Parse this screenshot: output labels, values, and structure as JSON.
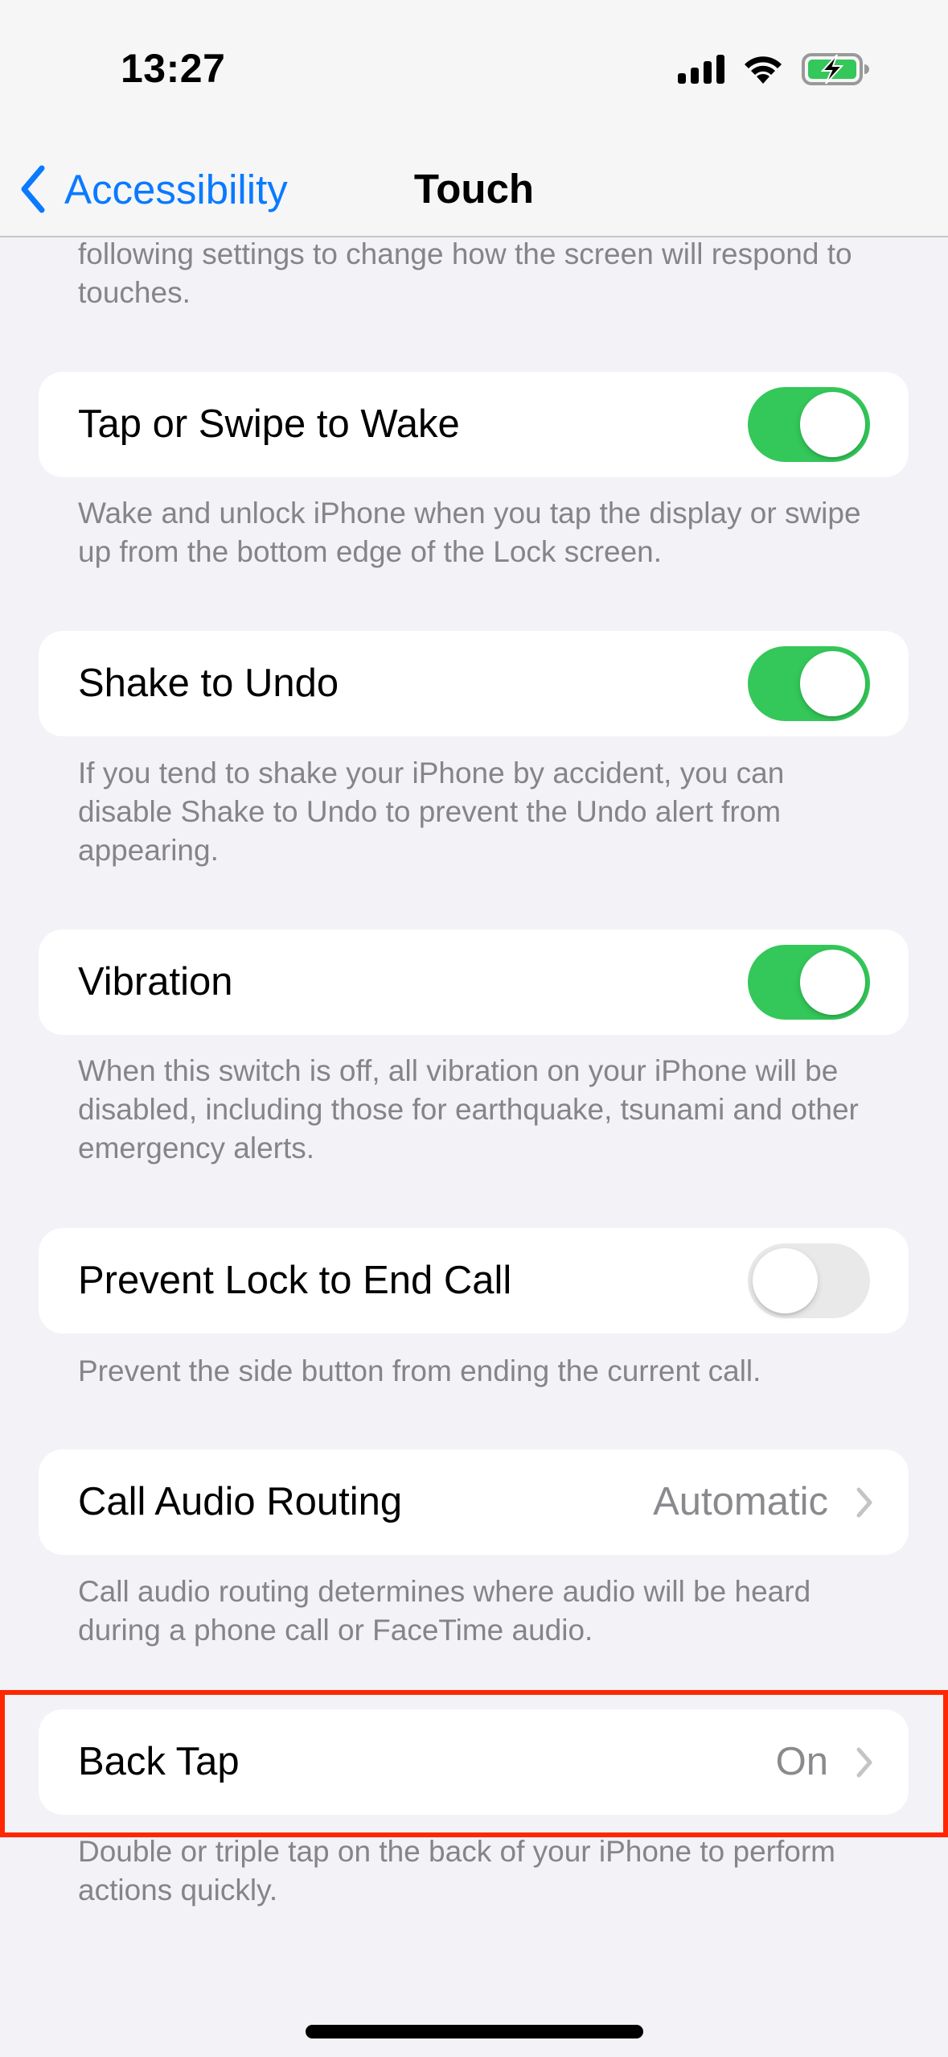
{
  "status_bar": {
    "time": "13:27",
    "icons": [
      "cellular-signal-icon",
      "wifi-icon",
      "battery-charging-icon"
    ],
    "battery_color": "#34c759"
  },
  "nav": {
    "back_label": "Accessibility",
    "title": "Touch",
    "accent_color": "#0a7aff"
  },
  "intro_text": "following settings to change how the screen will respond to touches.",
  "settings": [
    {
      "label": "Tap or Swipe to Wake",
      "control": "toggle",
      "state": "on",
      "description": "Wake and unlock iPhone when you tap the display or swipe up from the bottom edge of the Lock screen."
    },
    {
      "label": "Shake to Undo",
      "control": "toggle",
      "state": "on",
      "description": "If you tend to shake your iPhone by accident, you can disable Shake to Undo to prevent the Undo alert from appearing."
    },
    {
      "label": "Vibration",
      "control": "toggle",
      "state": "on",
      "description": "When this switch is off, all vibration on your iPhone will be disabled, including those for earthquake, tsunami and other emergency alerts."
    },
    {
      "label": "Prevent Lock to End Call",
      "control": "toggle",
      "state": "off",
      "description": "Prevent the side button from ending the current call."
    },
    {
      "label": "Call Audio Routing",
      "control": "disclosure",
      "value": "Automatic",
      "description": "Call audio routing determines where audio will be heard during a phone call or FaceTime audio."
    },
    {
      "label": "Back Tap",
      "control": "disclosure",
      "value": "On",
      "highlighted": true,
      "description": "Double or triple tap on the back of your iPhone to perform actions quickly."
    }
  ],
  "colors": {
    "toggle_on": "#34c759",
    "toggle_off": "#e9e9ea",
    "highlight_box": "#ff2600",
    "background": "#f2f2f7"
  }
}
